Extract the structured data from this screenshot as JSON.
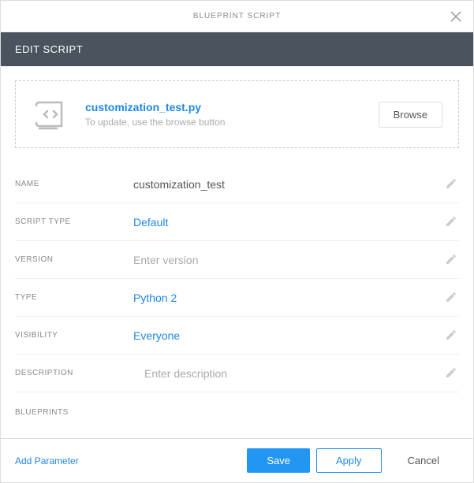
{
  "dialog": {
    "title": "BLUEPRINT SCRIPT",
    "section_header": "EDIT SCRIPT"
  },
  "file": {
    "name": "customization_test.py",
    "hint": "To update, use the browse button",
    "browse_label": "Browse"
  },
  "fields": {
    "name": {
      "label": "NAME",
      "value": "customization_test"
    },
    "script_type": {
      "label": "SCRIPT TYPE",
      "value": "Default"
    },
    "version": {
      "label": "VERSION",
      "placeholder": "Enter version"
    },
    "type": {
      "label": "TYPE",
      "value": "Python 2"
    },
    "visibility": {
      "label": "VISIBILITY",
      "value": "Everyone"
    },
    "description": {
      "label": "DESCRIPTION",
      "placeholder": "Enter description"
    }
  },
  "blueprints": {
    "label": "BLUEPRINTS"
  },
  "footer": {
    "add_parameter": "Add Parameter",
    "save": "Save",
    "apply": "Apply",
    "cancel": "Cancel"
  }
}
